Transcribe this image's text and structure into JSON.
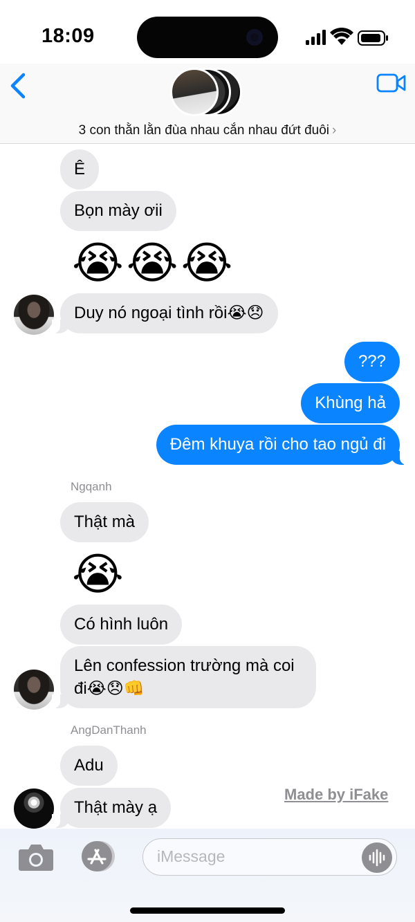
{
  "status_bar": {
    "time": "18:09"
  },
  "header": {
    "group_name": "3 con thằn lằn đùa nhau cắn nhau đứt đuôi",
    "chevron": "›",
    "icons": [
      "back-chevron-icon",
      "video-call-icon"
    ]
  },
  "messages": {
    "m1": "Ê",
    "m2": "Bọn mày ơii",
    "m3": "😭😭😭",
    "m4": "Duy nó ngoại tình rồi😭😞",
    "m5": "???",
    "m6": "Khùng hả",
    "m7": "Đêm khuya rồi cho tao ngủ đi",
    "sender1": "Ngqanh",
    "m8": "Thật mà",
    "m9": "😭",
    "m10": "Có hình luôn",
    "m11": "Lên confession trường mà coi đi😭😞👊",
    "sender2": "AngDanThanh",
    "m12": "Adu",
    "m13": "Thật mày ạ"
  },
  "watermark": "Made by iFake",
  "input": {
    "placeholder": "iMessage"
  },
  "colors": {
    "outgoing": "#0a84ff",
    "incoming": "#e9e9eb",
    "accent": "#0a84ff"
  }
}
